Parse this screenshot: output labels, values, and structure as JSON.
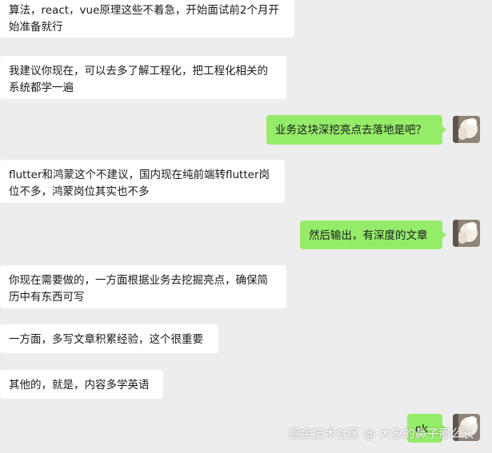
{
  "messages": [
    {
      "side": "left",
      "text": "算法，react，vue原理这些不着急，开始面试前2个月开始准备就行"
    },
    {
      "side": "left",
      "text": "我建议你现在，可以去多了解工程化，把工程化相关的系统都学一遍"
    },
    {
      "side": "right",
      "text": "业务这块深挖亮点去落地是吧？"
    },
    {
      "side": "left",
      "text": "flutter和鸿蒙这个不建议，国内现在纯前端转flutter岗位不多，鸿蒙岗位其实也不多"
    },
    {
      "side": "right",
      "text": "然后输出，有深度的文章"
    },
    {
      "side": "left",
      "text": "你现在需要做的，一方面根据业务去挖掘亮点，确保简历中有东西可写"
    },
    {
      "side": "left",
      "text": "一方面，多写文章积累经验，这个很重要"
    },
    {
      "side": "left",
      "text": "其他的，就是，内容多学英语"
    },
    {
      "side": "right",
      "text": "ok"
    }
  ],
  "watermark": "掘金技术社区 @ 大象的鼻子那么长"
}
